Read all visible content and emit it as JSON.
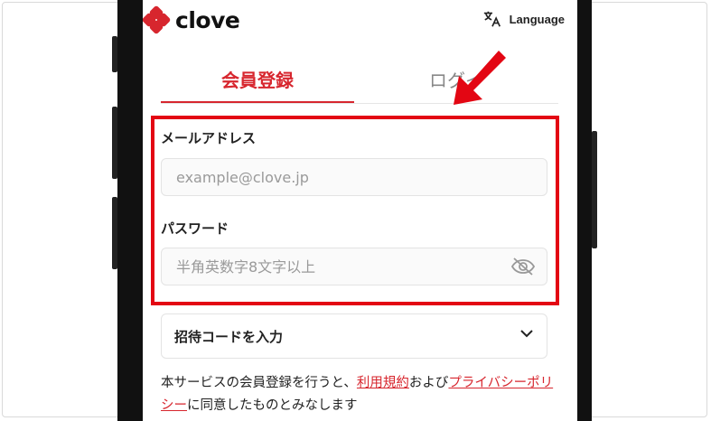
{
  "header": {
    "brand": "clove",
    "language_label": "Language",
    "language_icon": "translate-icon"
  },
  "tabs": [
    {
      "label": "会員登録",
      "active": true
    },
    {
      "label": "ログイ",
      "active": false
    }
  ],
  "email": {
    "label": "メールアドレス",
    "placeholder": "example@clove.jp",
    "value": ""
  },
  "password": {
    "label": "パスワード",
    "placeholder": "半角英数字8文字以上",
    "value": "",
    "toggle_icon": "eye-off-icon"
  },
  "invite": {
    "label": "招待コードを入力",
    "icon": "chevron-down-icon"
  },
  "terms": {
    "prefix": "本サービスの会員登録を行うと、",
    "link1": "利用規約",
    "middle": "および",
    "link2": "プライバシーポリシー",
    "suffix": "に同意したものとみなします"
  },
  "colors": {
    "brand_red": "#d7262e",
    "highlight_red": "#e30613"
  }
}
